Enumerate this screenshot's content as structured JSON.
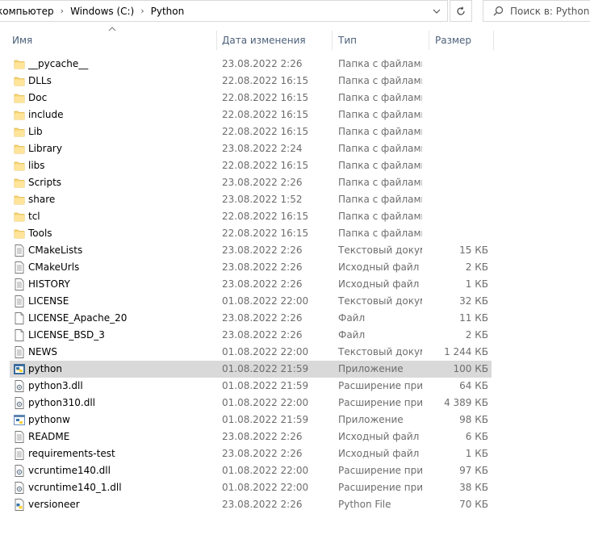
{
  "address": {
    "crumbs": [
      "компьютер",
      "Windows (C:)",
      "Python"
    ],
    "search_placeholder": "Поиск в: Python"
  },
  "columns": {
    "name": "Имя",
    "date": "Дата изменения",
    "type": "Тип",
    "size": "Размер"
  },
  "files": [
    {
      "name": "__pycache__",
      "date": "23.08.2022 2:26",
      "type": "Папка с файлами",
      "size": "",
      "icon": "folder-icon"
    },
    {
      "name": "DLLs",
      "date": "22.08.2022 16:15",
      "type": "Папка с файлами",
      "size": "",
      "icon": "folder-icon"
    },
    {
      "name": "Doc",
      "date": "22.08.2022 16:15",
      "type": "Папка с файлами",
      "size": "",
      "icon": "folder-icon"
    },
    {
      "name": "include",
      "date": "22.08.2022 16:15",
      "type": "Папка с файлами",
      "size": "",
      "icon": "folder-icon"
    },
    {
      "name": "Lib",
      "date": "22.08.2022 16:15",
      "type": "Папка с файлами",
      "size": "",
      "icon": "folder-icon"
    },
    {
      "name": "Library",
      "date": "23.08.2022 2:24",
      "type": "Папка с файлами",
      "size": "",
      "icon": "folder-icon"
    },
    {
      "name": "libs",
      "date": "22.08.2022 16:15",
      "type": "Папка с файлами",
      "size": "",
      "icon": "folder-icon"
    },
    {
      "name": "Scripts",
      "date": "23.08.2022 2:26",
      "type": "Папка с файлами",
      "size": "",
      "icon": "folder-icon"
    },
    {
      "name": "share",
      "date": "23.08.2022 1:52",
      "type": "Папка с файлами",
      "size": "",
      "icon": "folder-icon"
    },
    {
      "name": "tcl",
      "date": "22.08.2022 16:15",
      "type": "Папка с файлами",
      "size": "",
      "icon": "folder-icon"
    },
    {
      "name": "Tools",
      "date": "22.08.2022 16:15",
      "type": "Папка с файлами",
      "size": "",
      "icon": "folder-icon"
    },
    {
      "name": "CMakeLists",
      "date": "23.08.2022 2:26",
      "type": "Текстовый докум...",
      "size": "15 КБ",
      "icon": "text-file-icon"
    },
    {
      "name": "CMakeUrls",
      "date": "23.08.2022 2:26",
      "type": "Исходный файл ...",
      "size": "2 КБ",
      "icon": "text-file-icon"
    },
    {
      "name": "HISTORY",
      "date": "23.08.2022 2:26",
      "type": "Исходный файл ...",
      "size": "1 КБ",
      "icon": "text-file-icon"
    },
    {
      "name": "LICENSE",
      "date": "01.08.2022 22:00",
      "type": "Текстовый докум...",
      "size": "32 КБ",
      "icon": "text-file-icon"
    },
    {
      "name": "LICENSE_Apache_20",
      "date": "23.08.2022 2:26",
      "type": "Файл",
      "size": "11 КБ",
      "icon": "blank-file-icon"
    },
    {
      "name": "LICENSE_BSD_3",
      "date": "23.08.2022 2:26",
      "type": "Файл",
      "size": "2 КБ",
      "icon": "blank-file-icon"
    },
    {
      "name": "NEWS",
      "date": "01.08.2022 22:00",
      "type": "Текстовый докум...",
      "size": "1 244 КБ",
      "icon": "text-file-icon"
    },
    {
      "name": "python",
      "date": "01.08.2022 21:59",
      "type": "Приложение",
      "size": "100 КБ",
      "icon": "python-app-icon",
      "selected": true
    },
    {
      "name": "python3.dll",
      "date": "01.08.2022 21:59",
      "type": "Расширение при...",
      "size": "64 КБ",
      "icon": "dll-file-icon"
    },
    {
      "name": "python310.dll",
      "date": "01.08.2022 22:00",
      "type": "Расширение при...",
      "size": "4 389 КБ",
      "icon": "dll-file-icon"
    },
    {
      "name": "pythonw",
      "date": "01.08.2022 21:59",
      "type": "Приложение",
      "size": "98 КБ",
      "icon": "pythonw-app-icon"
    },
    {
      "name": "README",
      "date": "23.08.2022 2:26",
      "type": "Исходный файл ...",
      "size": "6 КБ",
      "icon": "text-file-icon"
    },
    {
      "name": "requirements-test",
      "date": "23.08.2022 2:26",
      "type": "Исходный файл ...",
      "size": "1 КБ",
      "icon": "text-file-icon"
    },
    {
      "name": "vcruntime140.dll",
      "date": "01.08.2022 22:00",
      "type": "Расширение при...",
      "size": "97 КБ",
      "icon": "dll-file-icon"
    },
    {
      "name": "vcruntime140_1.dll",
      "date": "01.08.2022 22:00",
      "type": "Расширение при...",
      "size": "38 КБ",
      "icon": "dll-file-icon"
    },
    {
      "name": "versioneer",
      "date": "23.08.2022 2:26",
      "type": "Python File",
      "size": "70 КБ",
      "icon": "python-file-icon"
    }
  ]
}
